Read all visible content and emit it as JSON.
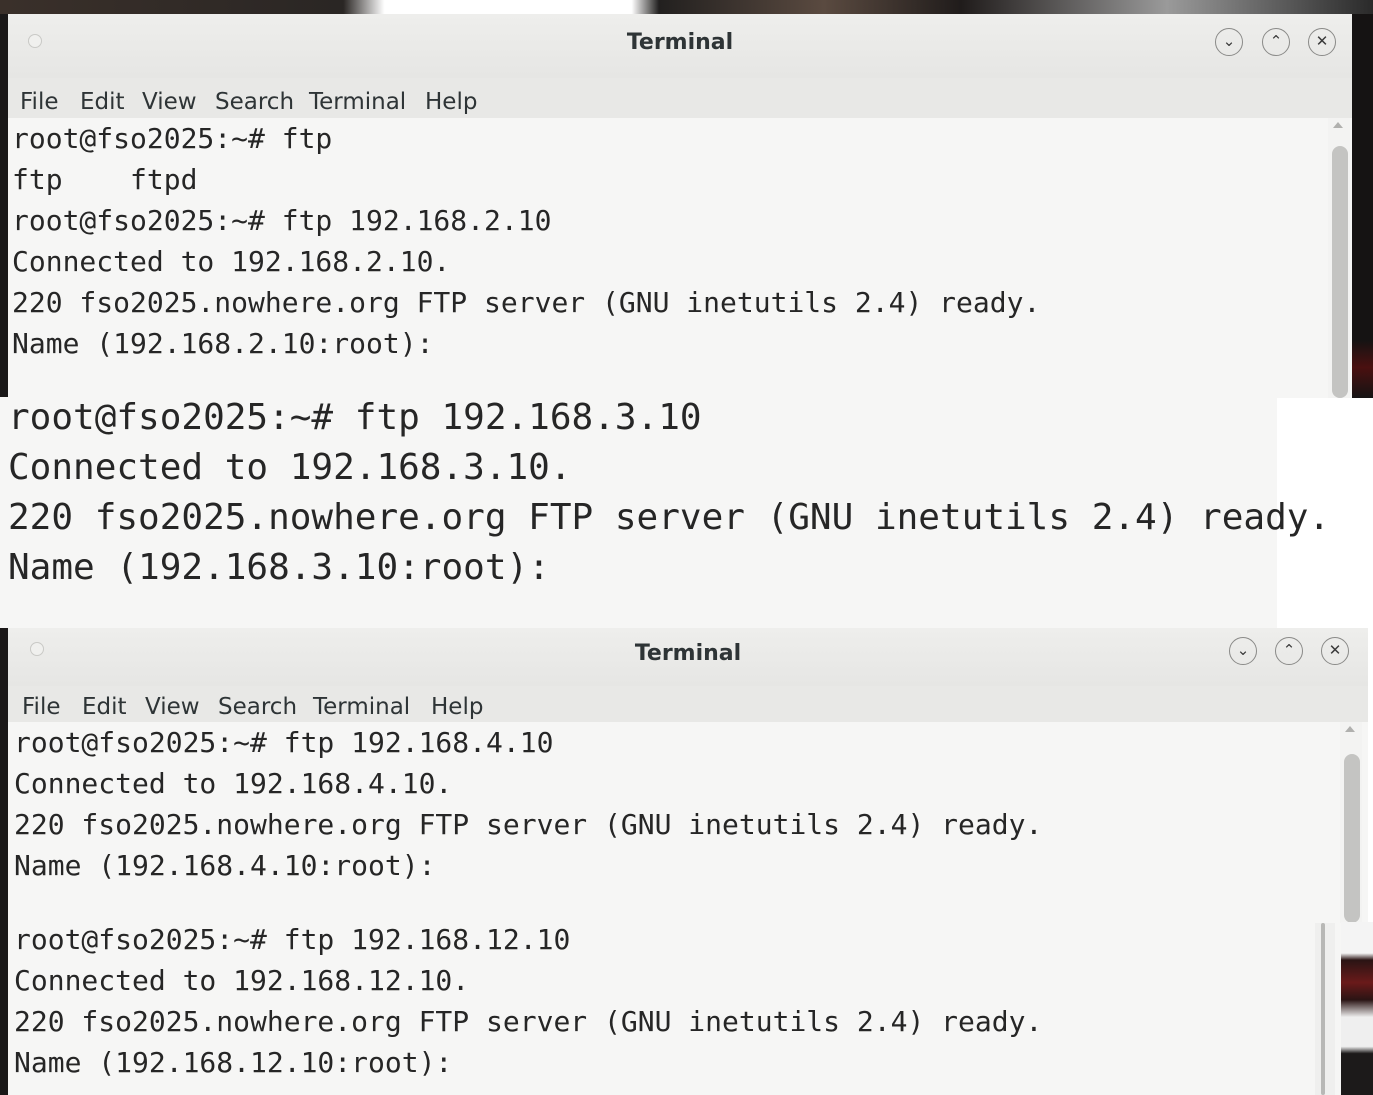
{
  "window1": {
    "title": "Terminal",
    "menu": [
      "File",
      "Edit",
      "View",
      "Search",
      "Terminal",
      "Help"
    ],
    "lines": [
      "root@fso2025:~# ftp",
      "ftp    ftpd",
      "root@fso2025:~# ftp 192.168.2.10",
      "Connected to 192.168.2.10.",
      "220 fso2025.nowhere.org FTP server (GNU inetutils 2.4) ready.",
      "Name (192.168.2.10:root):"
    ]
  },
  "panel_zoomed": {
    "lines": [
      "root@fso2025:~# ftp 192.168.3.10",
      "Connected to 192.168.3.10.",
      "220 fso2025.nowhere.org FTP server (GNU inetutils 2.4) ready.",
      "Name (192.168.3.10:root):"
    ]
  },
  "window2": {
    "title": "Terminal",
    "menu": [
      "File",
      "Edit",
      "View",
      "Search",
      "Terminal",
      "Help"
    ],
    "lines": [
      "root@fso2025:~# ftp 192.168.4.10",
      "Connected to 192.168.4.10.",
      "220 fso2025.nowhere.org FTP server (GNU inetutils 2.4) ready.",
      "Name (192.168.4.10:root):"
    ]
  },
  "panel_bottom": {
    "lines": [
      "root@fso2025:~# ftp 192.168.12.10",
      "Connected to 192.168.12.10.",
      "220 fso2025.nowhere.org FTP server (GNU inetutils 2.4) ready.",
      "Name (192.168.12.10:root):"
    ]
  },
  "icons": {
    "minimize": "chevron-down-icon",
    "maximize": "chevron-up-icon",
    "close": "close-icon"
  },
  "colors": {
    "terminal_bg": "#f6f6f5",
    "terminal_fg": "#262626",
    "titlebar_bg": "#e8e8e6"
  }
}
